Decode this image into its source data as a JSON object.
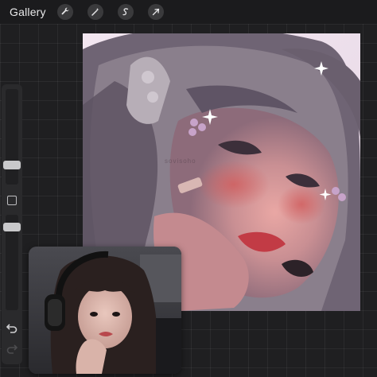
{
  "topbar": {
    "gallery_label": "Gallery",
    "tools": [
      {
        "icon": "wrench-icon",
        "label": "Actions"
      },
      {
        "icon": "magic-wand-icon",
        "label": "Adjustments"
      },
      {
        "icon": "selection-s-icon",
        "label": "Selection"
      },
      {
        "icon": "arrow-cursor-icon",
        "label": "Transform"
      }
    ]
  },
  "canvas": {
    "watermark": "sovisoho"
  },
  "colors": {
    "background": "#1f1f21",
    "toolbar": "#1b1b1d",
    "sidebar": "#2a2a2c",
    "canvas_bg": "#efe4ef"
  }
}
